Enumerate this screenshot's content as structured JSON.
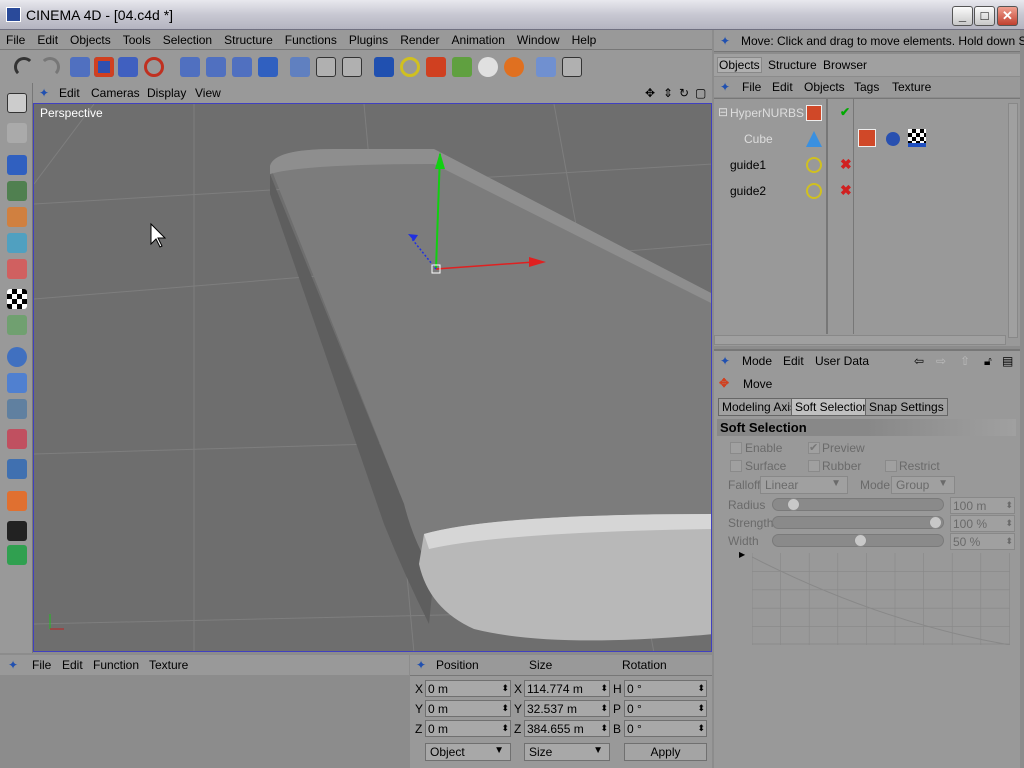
{
  "window": {
    "title": "CINEMA 4D - [04.c4d *]",
    "min": "_",
    "max": "□",
    "close": "✕"
  },
  "menu": [
    "File",
    "Edit",
    "Objects",
    "Tools",
    "Selection",
    "Structure",
    "Functions",
    "Plugins",
    "Render",
    "Animation",
    "Window",
    "Help"
  ],
  "viewport": {
    "menu": [
      "Edit",
      "Cameras",
      "Display",
      "View"
    ],
    "label": "Perspective"
  },
  "status": "Move: Click and drag to move elements. Hold down SHIFT",
  "object_manager": {
    "tabs": [
      "Objects",
      "Structure",
      "Browser"
    ],
    "menu": [
      "File",
      "Edit",
      "Objects",
      "Tags",
      "Texture"
    ],
    "objects": [
      {
        "name": "HyperNURBS",
        "state": "check"
      },
      {
        "name": "Cube",
        "state": ""
      },
      {
        "name": "guide1",
        "state": "x"
      },
      {
        "name": "guide2",
        "state": "x"
      }
    ]
  },
  "attributes": {
    "menu": [
      "Mode",
      "Edit",
      "User Data"
    ],
    "tool": "Move",
    "tabs": [
      "Modeling Axis",
      "Soft Selection",
      "Snap Settings"
    ],
    "active_tab": "Soft Selection",
    "section": "Soft Selection",
    "checkboxes": {
      "enable": "Enable",
      "preview": "Preview",
      "surface": "Surface",
      "rubber": "Rubber",
      "restrict": "Restrict"
    },
    "falloff_label": "Falloff",
    "falloff": "Linear",
    "mode_label": "Mode",
    "mode": "Group",
    "radius_label": "Radius",
    "radius": "100 m",
    "radius_level": 0.05,
    "strength_label": "Strength",
    "strength": "100 %",
    "strength_level": 1.0,
    "width_label": "Width",
    "width": "50 %",
    "width_level": 0.5
  },
  "material_manager": {
    "menu": [
      "File",
      "Edit",
      "Function",
      "Texture"
    ]
  },
  "coordinates": {
    "headers": [
      "Position",
      "Size",
      "Rotation"
    ],
    "position": {
      "X": "0 m",
      "Y": "0 m",
      "Z": "0 m"
    },
    "size": {
      "X": "114.774 m",
      "Y": "32.537 m",
      "Z": "384.655 m"
    },
    "rotation": {
      "H": "0 °",
      "P": "0 °",
      "B": "0 °"
    },
    "mode": "Object",
    "size_mode": "Size",
    "apply": "Apply"
  }
}
